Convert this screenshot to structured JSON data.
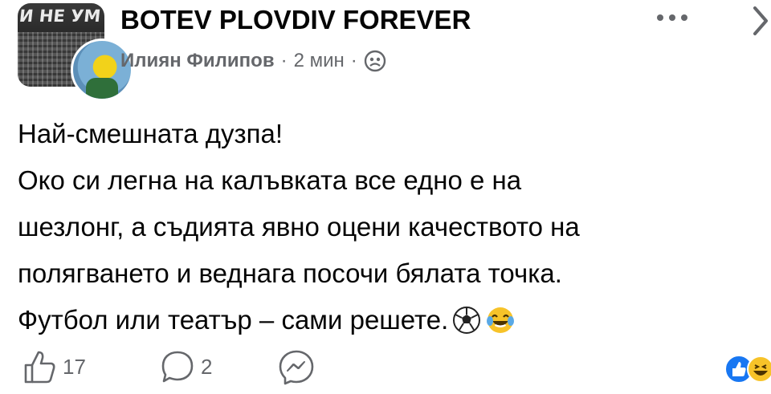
{
  "header": {
    "avatar_banner_text": "И НЕ УМ",
    "group_name": "BOTEV PLOVDIV FOREVER",
    "author": "Илиян Филипов",
    "separator": "·",
    "time": "2 мин",
    "audience_icon": "group-audience-icon",
    "more_icon": "more-options-icon",
    "chevron_icon": "chevron-right-icon"
  },
  "post": {
    "lines": [
      "Най-смешната дузпа!",
      "Око си легна на калъвката все едно е на",
      "шезлонг, а съдията явно оцени качеството на",
      "полягването и веднага посочи бялата точка.",
      "Футбол или театър – сами решете."
    ],
    "emojis": [
      "soccer-ball-emoji",
      "tears-of-joy-emoji"
    ]
  },
  "actions": {
    "like_icon": "thumbs-up-icon",
    "like_count": "17",
    "comment_icon": "comment-icon",
    "comment_count": "2",
    "messenger_icon": "messenger-icon"
  },
  "reactions": {
    "icons": [
      "like-reaction-icon",
      "haha-reaction-icon"
    ]
  },
  "colors": {
    "text_primary": "#050505",
    "text_secondary": "#65676b",
    "like_blue": "#1877f2",
    "emoji_yellow": "#f7c329"
  }
}
